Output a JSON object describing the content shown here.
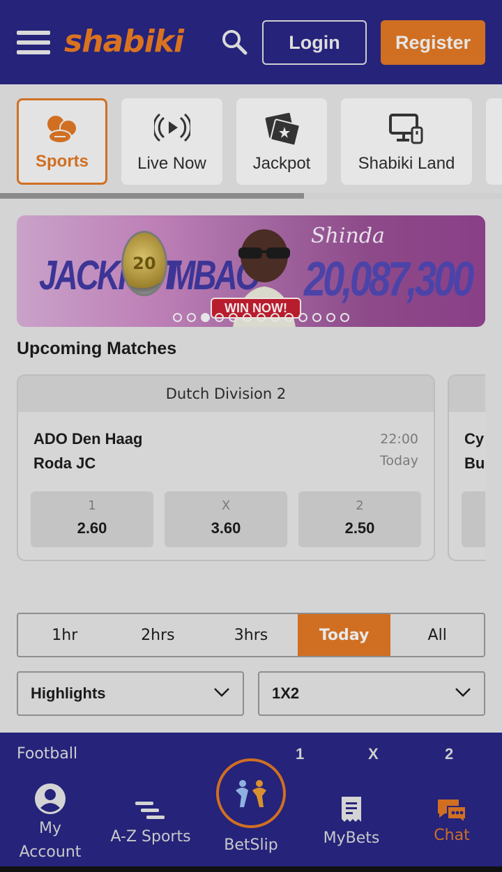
{
  "header": {
    "logo_text": "shabiki",
    "login_label": "Login",
    "register_label": "Register"
  },
  "categories": [
    {
      "label": "Sports",
      "icon": "sports-balls-icon",
      "active": true
    },
    {
      "label": "Live Now",
      "icon": "live-broadcast-icon",
      "active": false
    },
    {
      "label": "Jackpot",
      "icon": "jackpot-tickets-icon",
      "active": false
    },
    {
      "label": "Shabiki Land",
      "icon": "computer-device-icon",
      "active": false
    }
  ],
  "banner": {
    "left_word": "JACKPOT",
    "right_word": "MBAO",
    "coin_text": "20",
    "shinda": "Shinda",
    "amount": "20,087,300",
    "cta": "WIN NOW!",
    "active_slide": 2,
    "slide_count": 13
  },
  "upcoming": {
    "title": "Upcoming Matches",
    "cards": [
      {
        "league": "Dutch Division 2",
        "home": "ADO Den Haag",
        "away": "Roda JC",
        "time": "22:00",
        "day": "Today",
        "odds": [
          {
            "key": "1",
            "value": "2.60"
          },
          {
            "key": "X",
            "value": "3.60"
          },
          {
            "key": "2",
            "value": "2.50"
          }
        ]
      },
      {
        "league": "",
        "home": "Cy",
        "away": "Bu"
      }
    ]
  },
  "time_filter": {
    "options": [
      "1hr",
      "2hrs",
      "3hrs",
      "Today",
      "All"
    ],
    "selected": "Today"
  },
  "filters": {
    "market_group": "Highlights",
    "market_type": "1X2"
  },
  "sport_bar": {
    "sport": "Football",
    "cols": [
      "1",
      "X",
      "2"
    ]
  },
  "bottom_nav": {
    "my_account": "My\nAccount",
    "my_account_line1": "My",
    "my_account_line2": "Account",
    "az_sports": "A-Z Sports",
    "betslip": "BetSlip",
    "mybets": "MyBets",
    "chat": "Chat"
  },
  "colors": {
    "brand_navy": "#25237a",
    "brand_orange": "#d06f22"
  }
}
